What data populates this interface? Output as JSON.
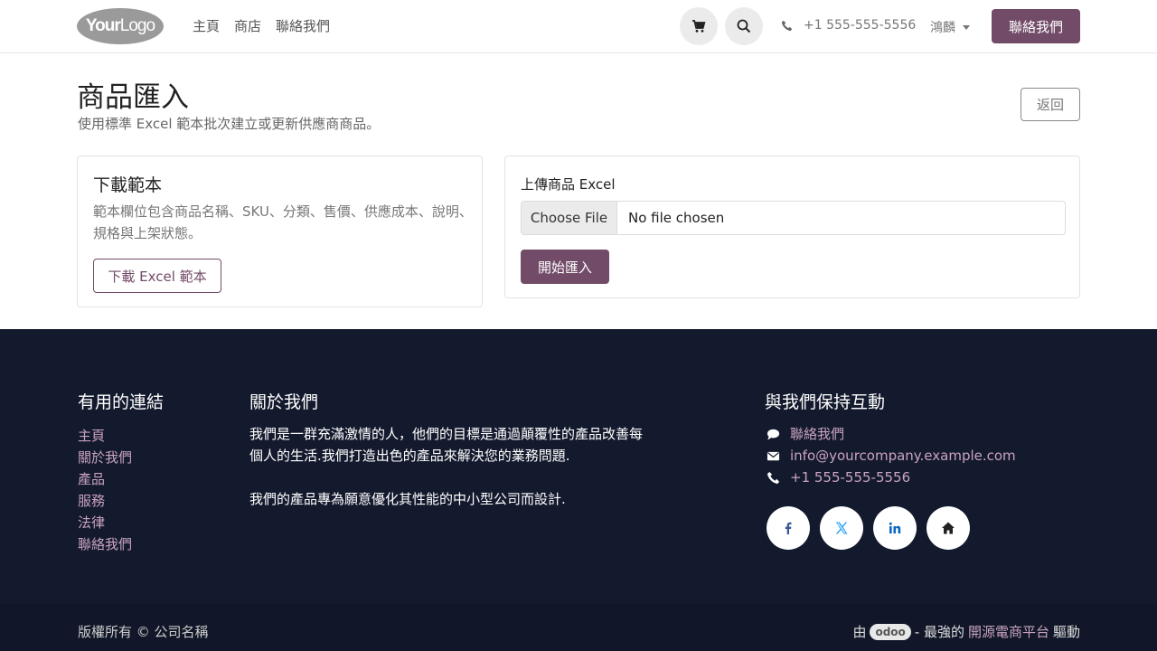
{
  "header": {
    "logo": {
      "part1": "Your",
      "part2": "Logo"
    },
    "nav": [
      "主頁",
      "商店",
      "聯絡我們"
    ],
    "phone": "+1 555-555-5556",
    "user": "鴻麟",
    "contact_button": "聯絡我們"
  },
  "main": {
    "title": "商品匯入",
    "subtitle": "使用標準 Excel 範本批次建立或更新供應商商品。",
    "back_button": "返回",
    "template_card": {
      "title": "下載範本",
      "description": "範本欄位包含商品名稱、SKU、分類、售價、供應成本、說明、規格與上架狀態。",
      "button": "下載 Excel 範本"
    },
    "upload_card": {
      "label": "上傳商品 Excel",
      "choose_file": "Choose File",
      "file_name": "No file chosen",
      "button": "開始匯入"
    }
  },
  "footer": {
    "links_title": "有用的連結",
    "links": [
      "主頁",
      "關於我們",
      "產品",
      "服務",
      "法律",
      "聯絡我們"
    ],
    "about_title": "關於我們",
    "about_p1": "我們是一群充滿激情的人，他們的目標是通過顛覆性的產品改善每個人的生活.我們打造出色的產品來解決您的業務問題.",
    "about_p2": "我們的產品專為願意優化其性能的中小型公司而設計.",
    "contact_title": "與我們保持互動",
    "contact_us": "聯絡我們",
    "email": "info@yourcompany.example.com",
    "phone": "+1 555-555-5556",
    "socials": [
      "facebook-icon",
      "x-icon",
      "linkedin-icon",
      "home-icon"
    ],
    "copyright": "版權所有 © 公司名稱",
    "powered_prefix": "由",
    "powered_brand": "odoo",
    "powered_mid": "- 最強的",
    "powered_link": "開源電商平台",
    "powered_suffix": "驅動"
  },
  "colors": {
    "brand": "#714b67",
    "footer_bg": "#141a2e",
    "footer_link": "#c9a3bf"
  }
}
